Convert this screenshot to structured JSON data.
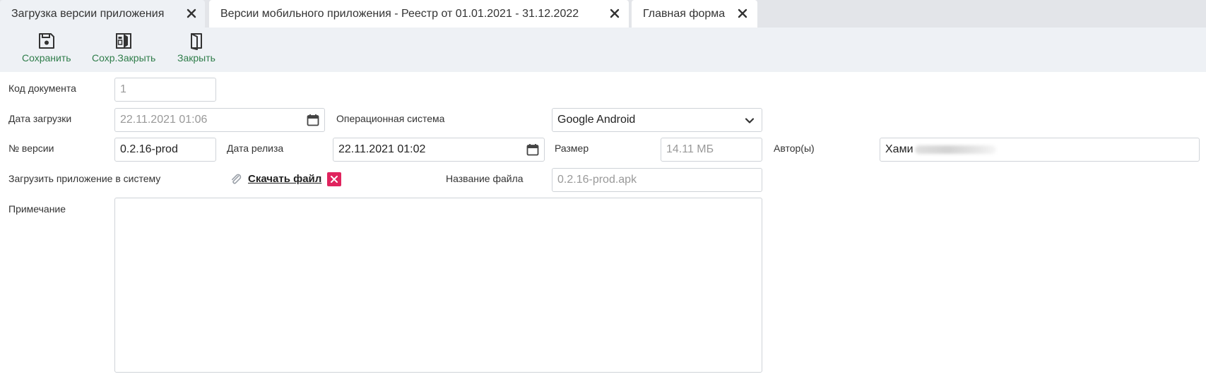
{
  "tabs": [
    {
      "label": "Загрузка версии приложения",
      "active": true
    },
    {
      "label": "Версии мобильного приложения - Реестр от 01.01.2021 - 31.12.2022",
      "active": false
    },
    {
      "label": "Главная форма",
      "active": false
    }
  ],
  "toolbar": {
    "save_label": "Сохранить",
    "save_close_label": "Сохр.Закрыть",
    "close_label": "Закрыть"
  },
  "form": {
    "doc_code_label": "Код документа",
    "doc_code_value": "1",
    "upload_date_label": "Дата загрузки",
    "upload_date_value": "22.11.2021 01:06",
    "os_label": "Операционная система",
    "os_value": "Google Android",
    "version_label": "№ версии",
    "version_value": "0.2.16-prod",
    "release_date_label": "Дата релиза",
    "release_date_value": "22.11.2021 01:02",
    "size_label": "Размер",
    "size_value": "14.11 МБ",
    "authors_label": "Автор(ы)",
    "authors_value": "Хами",
    "upload_label": "Загрузить приложение в систему",
    "download_link": "Скачать файл",
    "filename_label": "Название файла",
    "filename_value": "0.2.16-prod.apk",
    "note_label": "Примечание",
    "note_value": ""
  },
  "colors": {
    "toolbar_text": "#2f7d4a",
    "delete_button": "#e0245e",
    "tabbar_bg": "#e3e5e9",
    "toolbar_bg": "#eef1f5"
  },
  "icons": {
    "save": "floppy-disk-icon",
    "save_close": "save-close-icon",
    "close": "door-icon",
    "calendar": "calendar-icon",
    "dropdown": "chevron-down-icon",
    "attachment": "paperclip-icon",
    "delete": "close-icon",
    "tab_close": "close-icon"
  }
}
